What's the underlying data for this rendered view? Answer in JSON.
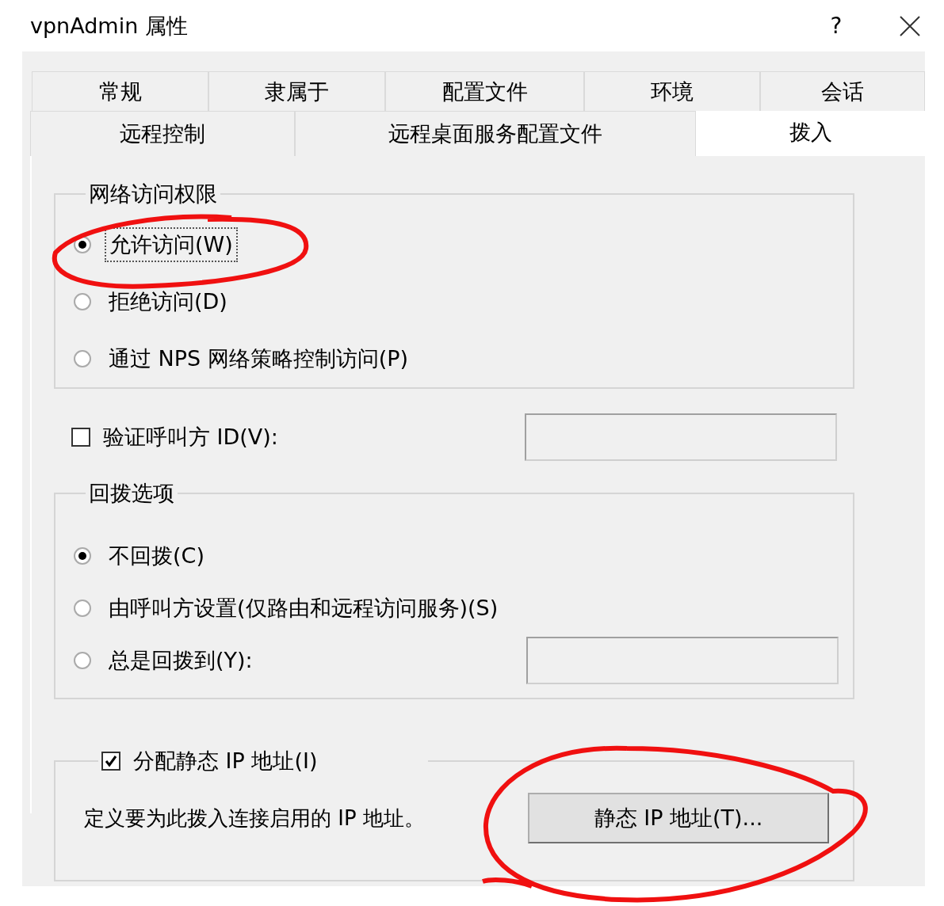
{
  "window": {
    "title": "vpnAdmin 属性",
    "help_button": "?"
  },
  "tab_rows": [
    {
      "tabs": [
        {
          "label": "常规",
          "selected": false
        },
        {
          "label": "隶属于",
          "selected": false
        },
        {
          "label": "配置文件",
          "selected": false
        },
        {
          "label": "环境",
          "selected": false
        },
        {
          "label": "会话",
          "selected": false
        }
      ]
    },
    {
      "tabs": [
        {
          "label": "远程控制",
          "selected": false
        },
        {
          "label": "远程桌面服务配置文件",
          "selected": false
        },
        {
          "label": "拨入",
          "selected": true
        }
      ]
    }
  ],
  "network_access": {
    "title": "网络访问权限",
    "options": [
      {
        "label": "允许访问(W)",
        "selected": true,
        "focused": true,
        "circled": true
      },
      {
        "label": "拒绝访问(D)",
        "selected": false,
        "focused": false,
        "circled": false
      },
      {
        "label": "通过 NPS 网络策略控制访问(P)",
        "selected": false,
        "focused": false,
        "circled": false
      }
    ]
  },
  "verify_caller_id": {
    "label": "验证呼叫方 ID(V):",
    "checked": false
  },
  "callback": {
    "title": "回拨选项",
    "options": [
      {
        "kind": "radio",
        "label": "不回拨(C)",
        "selected": true
      },
      {
        "kind": "radio",
        "label": "由呼叫方设置(仅路由和远程访问服务)(S)",
        "selected": false
      },
      {
        "kind": "radio-field",
        "label": "总是回拨到(Y):",
        "selected": false
      }
    ]
  },
  "static_ip": {
    "label": "分配静态 IP 地址(I)",
    "checked": true,
    "description": "定义要为此拨入连接启用的 IP 地址。",
    "button": "静态 IP 地址(T)...",
    "button_circled": true
  }
}
